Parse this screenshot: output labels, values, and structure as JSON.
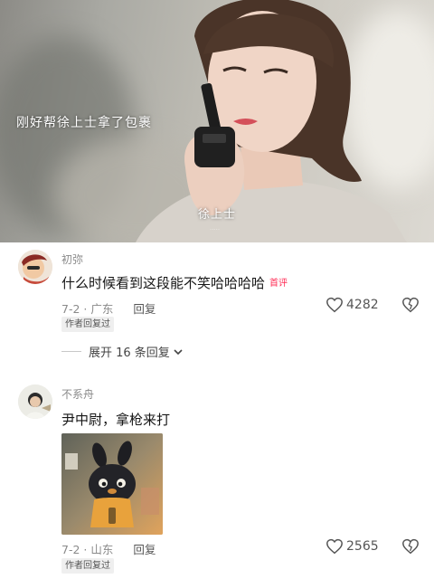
{
  "video": {
    "caption_left": "刚好帮徐上士拿了包裹",
    "caption_bottom": "徐上士",
    "watermark": "....."
  },
  "comments": [
    {
      "username": "初弥",
      "text": "什么时候看到这段能不笑哈哈哈哈",
      "badge": "首评",
      "date_location": "7-2 · 广东",
      "reply_label": "回复",
      "author_chip": "作者回复过",
      "likes": "4282",
      "expand_label": "展开 16 条回复"
    },
    {
      "username": "不系舟",
      "text": "尹中尉，拿枪来打",
      "date_location": "7-2 · 山东",
      "reply_label": "回复",
      "author_chip": "作者回复过",
      "likes": "2565"
    }
  ],
  "colors": {
    "badge": "#ff2c55",
    "muted": "#8a8a8a"
  }
}
